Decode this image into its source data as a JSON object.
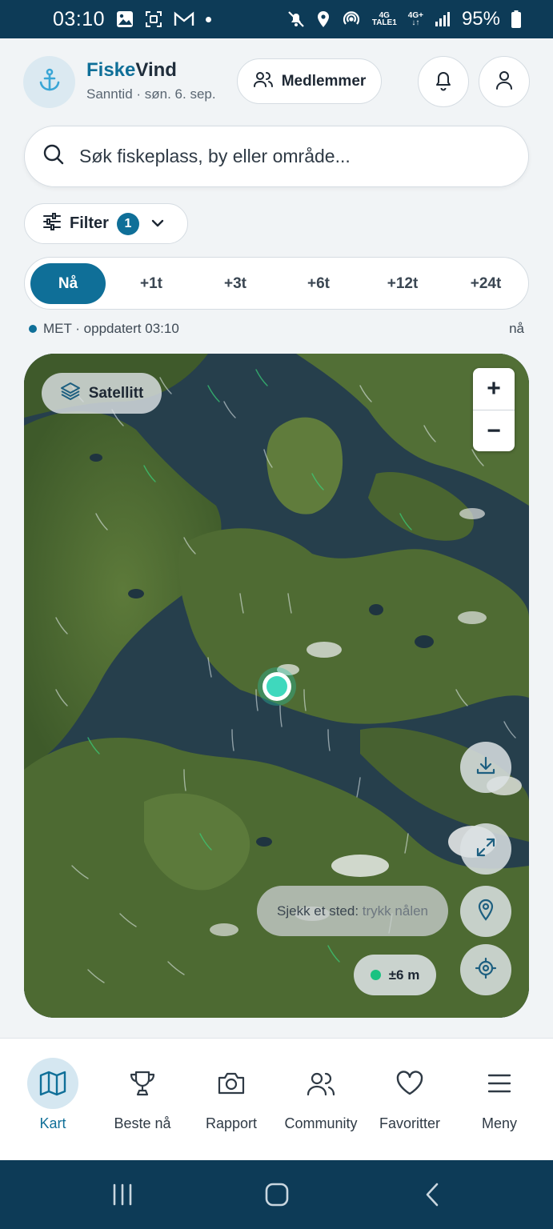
{
  "status_bar": {
    "time": "03:10",
    "network_top": "4G",
    "network_bottom": "TALE1",
    "network2_top": "4G+",
    "battery": "95%",
    "left_icons": [
      "gallery-icon",
      "screenshot-icon",
      "gmail-icon",
      "notification-dot"
    ],
    "right_icons": [
      "mute-icon",
      "location-icon",
      "hotspot-icon",
      "signal-icon",
      "battery-icon"
    ]
  },
  "header": {
    "brand_part1": "Fiske",
    "brand_part2": "Vind",
    "subtitle": "Sanntid · søn. 6. sep.",
    "members_label": "Medlemmer",
    "logo_icon": "anchor-icon"
  },
  "search": {
    "placeholder": "Søk fiskeplass, by eller område..."
  },
  "filter": {
    "label": "Filter",
    "count": "1"
  },
  "time_tabs": [
    {
      "label": "Nå",
      "active": true
    },
    {
      "label": "+1t"
    },
    {
      "label": "+3t"
    },
    {
      "label": "+6t"
    },
    {
      "label": "+12t"
    },
    {
      "label": "+24t"
    }
  ],
  "update_line": {
    "source": "MET · oppdatert 03:10",
    "age": "nå"
  },
  "map": {
    "layer_label": "Satellitt",
    "zoom_in": "+",
    "zoom_out": "−",
    "hint_main": "Sjekk et sted:",
    "hint_muted": "trykk nålen",
    "accuracy": "±6 m"
  },
  "bottom_nav": [
    {
      "label": "Kart",
      "icon": "map-icon",
      "active": true
    },
    {
      "label": "Beste nå",
      "icon": "trophy-icon"
    },
    {
      "label": "Rapport",
      "icon": "camera-icon"
    },
    {
      "label": "Community",
      "icon": "users-icon"
    },
    {
      "label": "Favoritter",
      "icon": "heart-icon"
    },
    {
      "label": "Meny",
      "icon": "menu-icon"
    }
  ],
  "colors": {
    "accent": "#0f6f98",
    "system_bar": "#0d3b57",
    "pin": "#3fd8bd",
    "accuracy_dot": "#19c281"
  }
}
